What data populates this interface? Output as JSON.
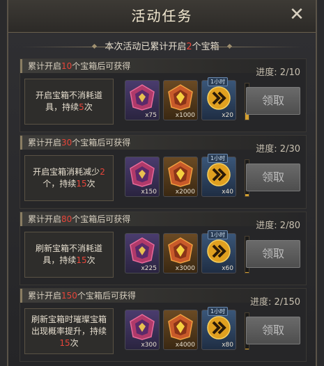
{
  "window": {
    "title": "活动任务"
  },
  "summary": {
    "prefix": "本次活动已累计开启",
    "count": "2",
    "suffix": "个宝箱"
  },
  "tasks": [
    {
      "head_prefix": "累计开启",
      "head_count": "10",
      "head_suffix": "个宝箱后可获得",
      "desc_lines": [
        "开启宝箱不消耗道",
        "具，持续",
        "5",
        "次"
      ],
      "rewards": [
        {
          "qty": "x75"
        },
        {
          "qty": "x1000"
        },
        {
          "qty": "x20",
          "tag": "1小时"
        }
      ],
      "progress_label": "进度: 2/10",
      "progress_value": 0.2,
      "claim": "领取"
    },
    {
      "head_prefix": "累计开启",
      "head_count": "30",
      "head_suffix": "个宝箱后可获得",
      "desc_lines": [
        "开启宝箱消耗减少",
        "2",
        "个，持续",
        "15",
        "次"
      ],
      "rewards": [
        {
          "qty": "x150"
        },
        {
          "qty": "x2000"
        },
        {
          "qty": "x40",
          "tag": "1小时"
        }
      ],
      "progress_label": "进度: 2/30",
      "progress_value": 0.067,
      "claim": "领取"
    },
    {
      "head_prefix": "累计开启",
      "head_count": "80",
      "head_suffix": "个宝箱后可获得",
      "desc_lines": [
        "刷新宝箱不消耗道",
        "具，持续",
        "15",
        "次"
      ],
      "rewards": [
        {
          "qty": "x225"
        },
        {
          "qty": "x3000"
        },
        {
          "qty": "x60",
          "tag": "1小时"
        }
      ],
      "progress_label": "进度: 2/80",
      "progress_value": 0.025,
      "claim": "领取"
    },
    {
      "head_prefix": "累计开启",
      "head_count": "150",
      "head_suffix": "个宝箱后可获得",
      "desc_lines": [
        "刷新宝箱时璀璨宝箱",
        "出现概率提升，持续",
        "15",
        "次"
      ],
      "rewards": [
        {
          "qty": "x300"
        },
        {
          "qty": "x4000"
        },
        {
          "qty": "x80",
          "tag": "1小时"
        }
      ],
      "progress_label": "进度: 2/150",
      "progress_value": 0.013,
      "claim": "领取"
    }
  ],
  "colors": {
    "highlight": "#e8453a",
    "accent": "#d4a030"
  },
  "icons": {
    "close": "close-icon",
    "item1": "purple-crest-icon",
    "item2": "gold-crest-icon",
    "item3": "speedup-chevron-icon"
  }
}
